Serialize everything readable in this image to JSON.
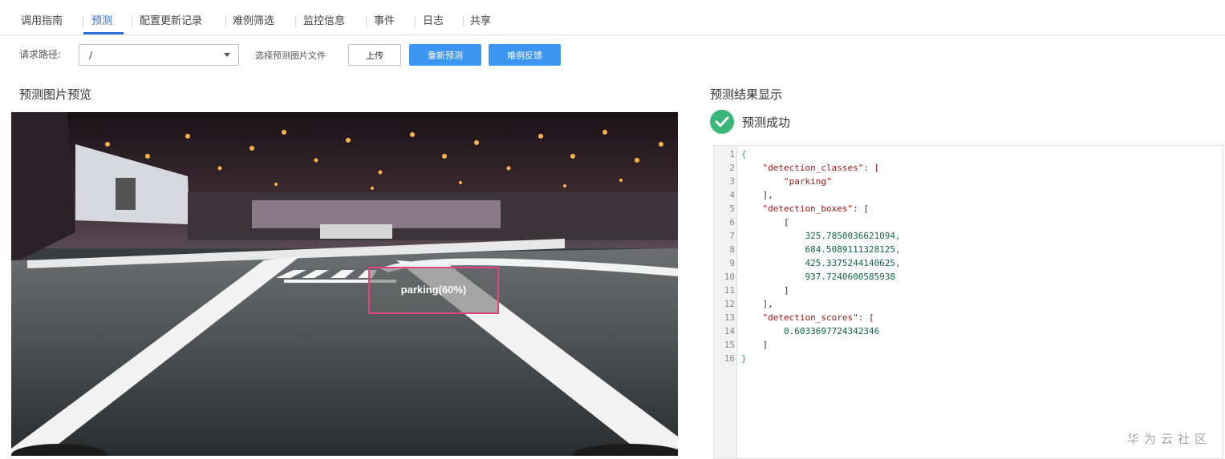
{
  "tabs": [
    {
      "label": "调用指南",
      "active": false
    },
    {
      "label": "预测",
      "active": true
    },
    {
      "label": "配置更新记录",
      "active": false
    },
    {
      "label": "难例筛选",
      "active": false
    },
    {
      "label": "监控信息",
      "active": false
    },
    {
      "label": "事件",
      "active": false
    },
    {
      "label": "日志",
      "active": false
    },
    {
      "label": "共享",
      "active": false
    }
  ],
  "toolbar": {
    "request_path_label": "请求路径:",
    "request_path_value": "/",
    "file_label": "选择预测图片文件",
    "upload_label": "上传",
    "repredict_label": "重新预测",
    "hard_case_feedback_label": "难例反馈"
  },
  "preview": {
    "title": "预测图片预览",
    "detection_label": "parking(60%)"
  },
  "result": {
    "title": "预测结果显示",
    "status": "预测成功",
    "status_color": "#3bb679",
    "code_lines": [
      {
        "num": "1",
        "text": "{"
      },
      {
        "num": "2",
        "text": "    \"detection_classes\": ["
      },
      {
        "num": "3",
        "text": "        \"parking\""
      },
      {
        "num": "4",
        "text": "    ],"
      },
      {
        "num": "5",
        "text": "    \"detection_boxes\": ["
      },
      {
        "num": "6",
        "text": "        ["
      },
      {
        "num": "7",
        "text": "            325.7850036621094,"
      },
      {
        "num": "8",
        "text": "            684.5089111328125,"
      },
      {
        "num": "9",
        "text": "            425.3375244140625,"
      },
      {
        "num": "10",
        "text": "            937.7240600585938"
      },
      {
        "num": "11",
        "text": "        ]"
      },
      {
        "num": "12",
        "text": "    ],"
      },
      {
        "num": "13",
        "text": "    \"detection_scores\": ["
      },
      {
        "num": "14",
        "text": "        0.6033697724342346"
      },
      {
        "num": "15",
        "text": "    ]"
      },
      {
        "num": "16",
        "text": "}"
      }
    ]
  },
  "watermark": "华为云社区",
  "colors": {
    "accent": "#2f6fd1",
    "primary_button": "#3a96f0",
    "detection_box": "#e0457b"
  },
  "icons": {
    "success": "check-circle-icon",
    "dropdown": "chevron-down-icon"
  }
}
